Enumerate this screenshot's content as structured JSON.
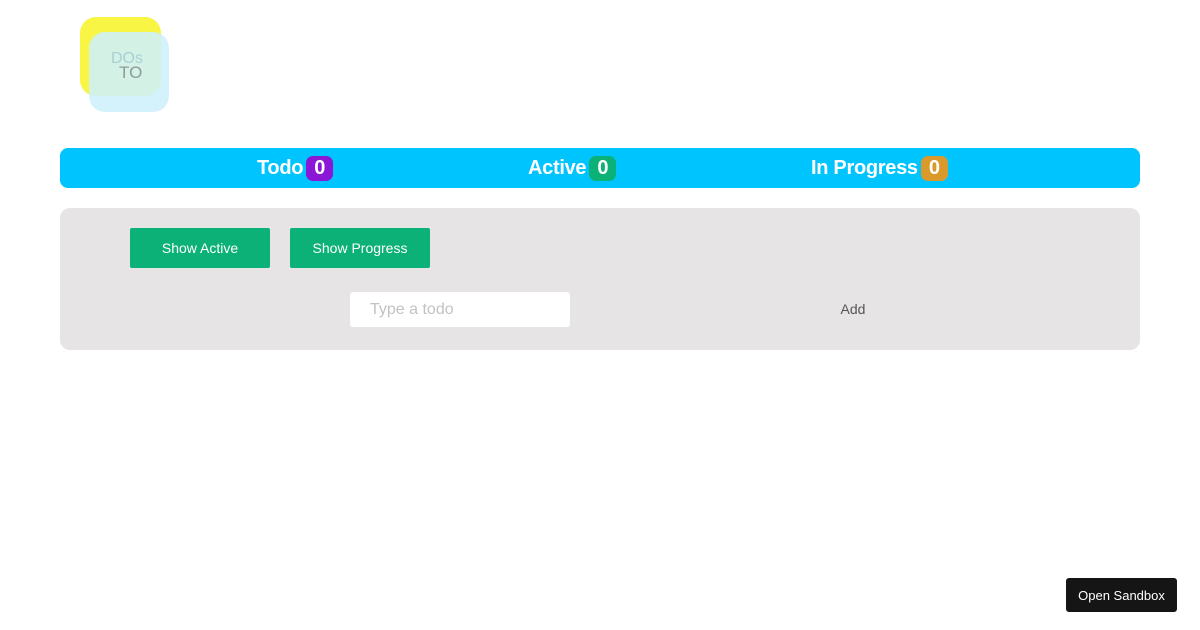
{
  "logo": {
    "text_top": "DOs",
    "text_bottom": "TO"
  },
  "status": {
    "items": [
      {
        "label": "Todo",
        "count": "0",
        "badge_color": "#8a16d6"
      },
      {
        "label": "Active",
        "count": "0",
        "badge_color": "#0bb176"
      },
      {
        "label": "In Progress",
        "count": "0",
        "badge_color": "#da9a2b"
      }
    ]
  },
  "controls": {
    "show_active_label": "Show Active",
    "show_progress_label": "Show Progress",
    "input_value": "",
    "input_placeholder": "Type a todo",
    "add_label": "Add"
  },
  "sandbox": {
    "label": "Open Sandbox"
  },
  "colors": {
    "status_bar": "#00c4fe",
    "panel": "#e6e4e5",
    "button": "#0bb176",
    "logo_back": "#f8f545",
    "logo_front": "#cdf0fa"
  }
}
